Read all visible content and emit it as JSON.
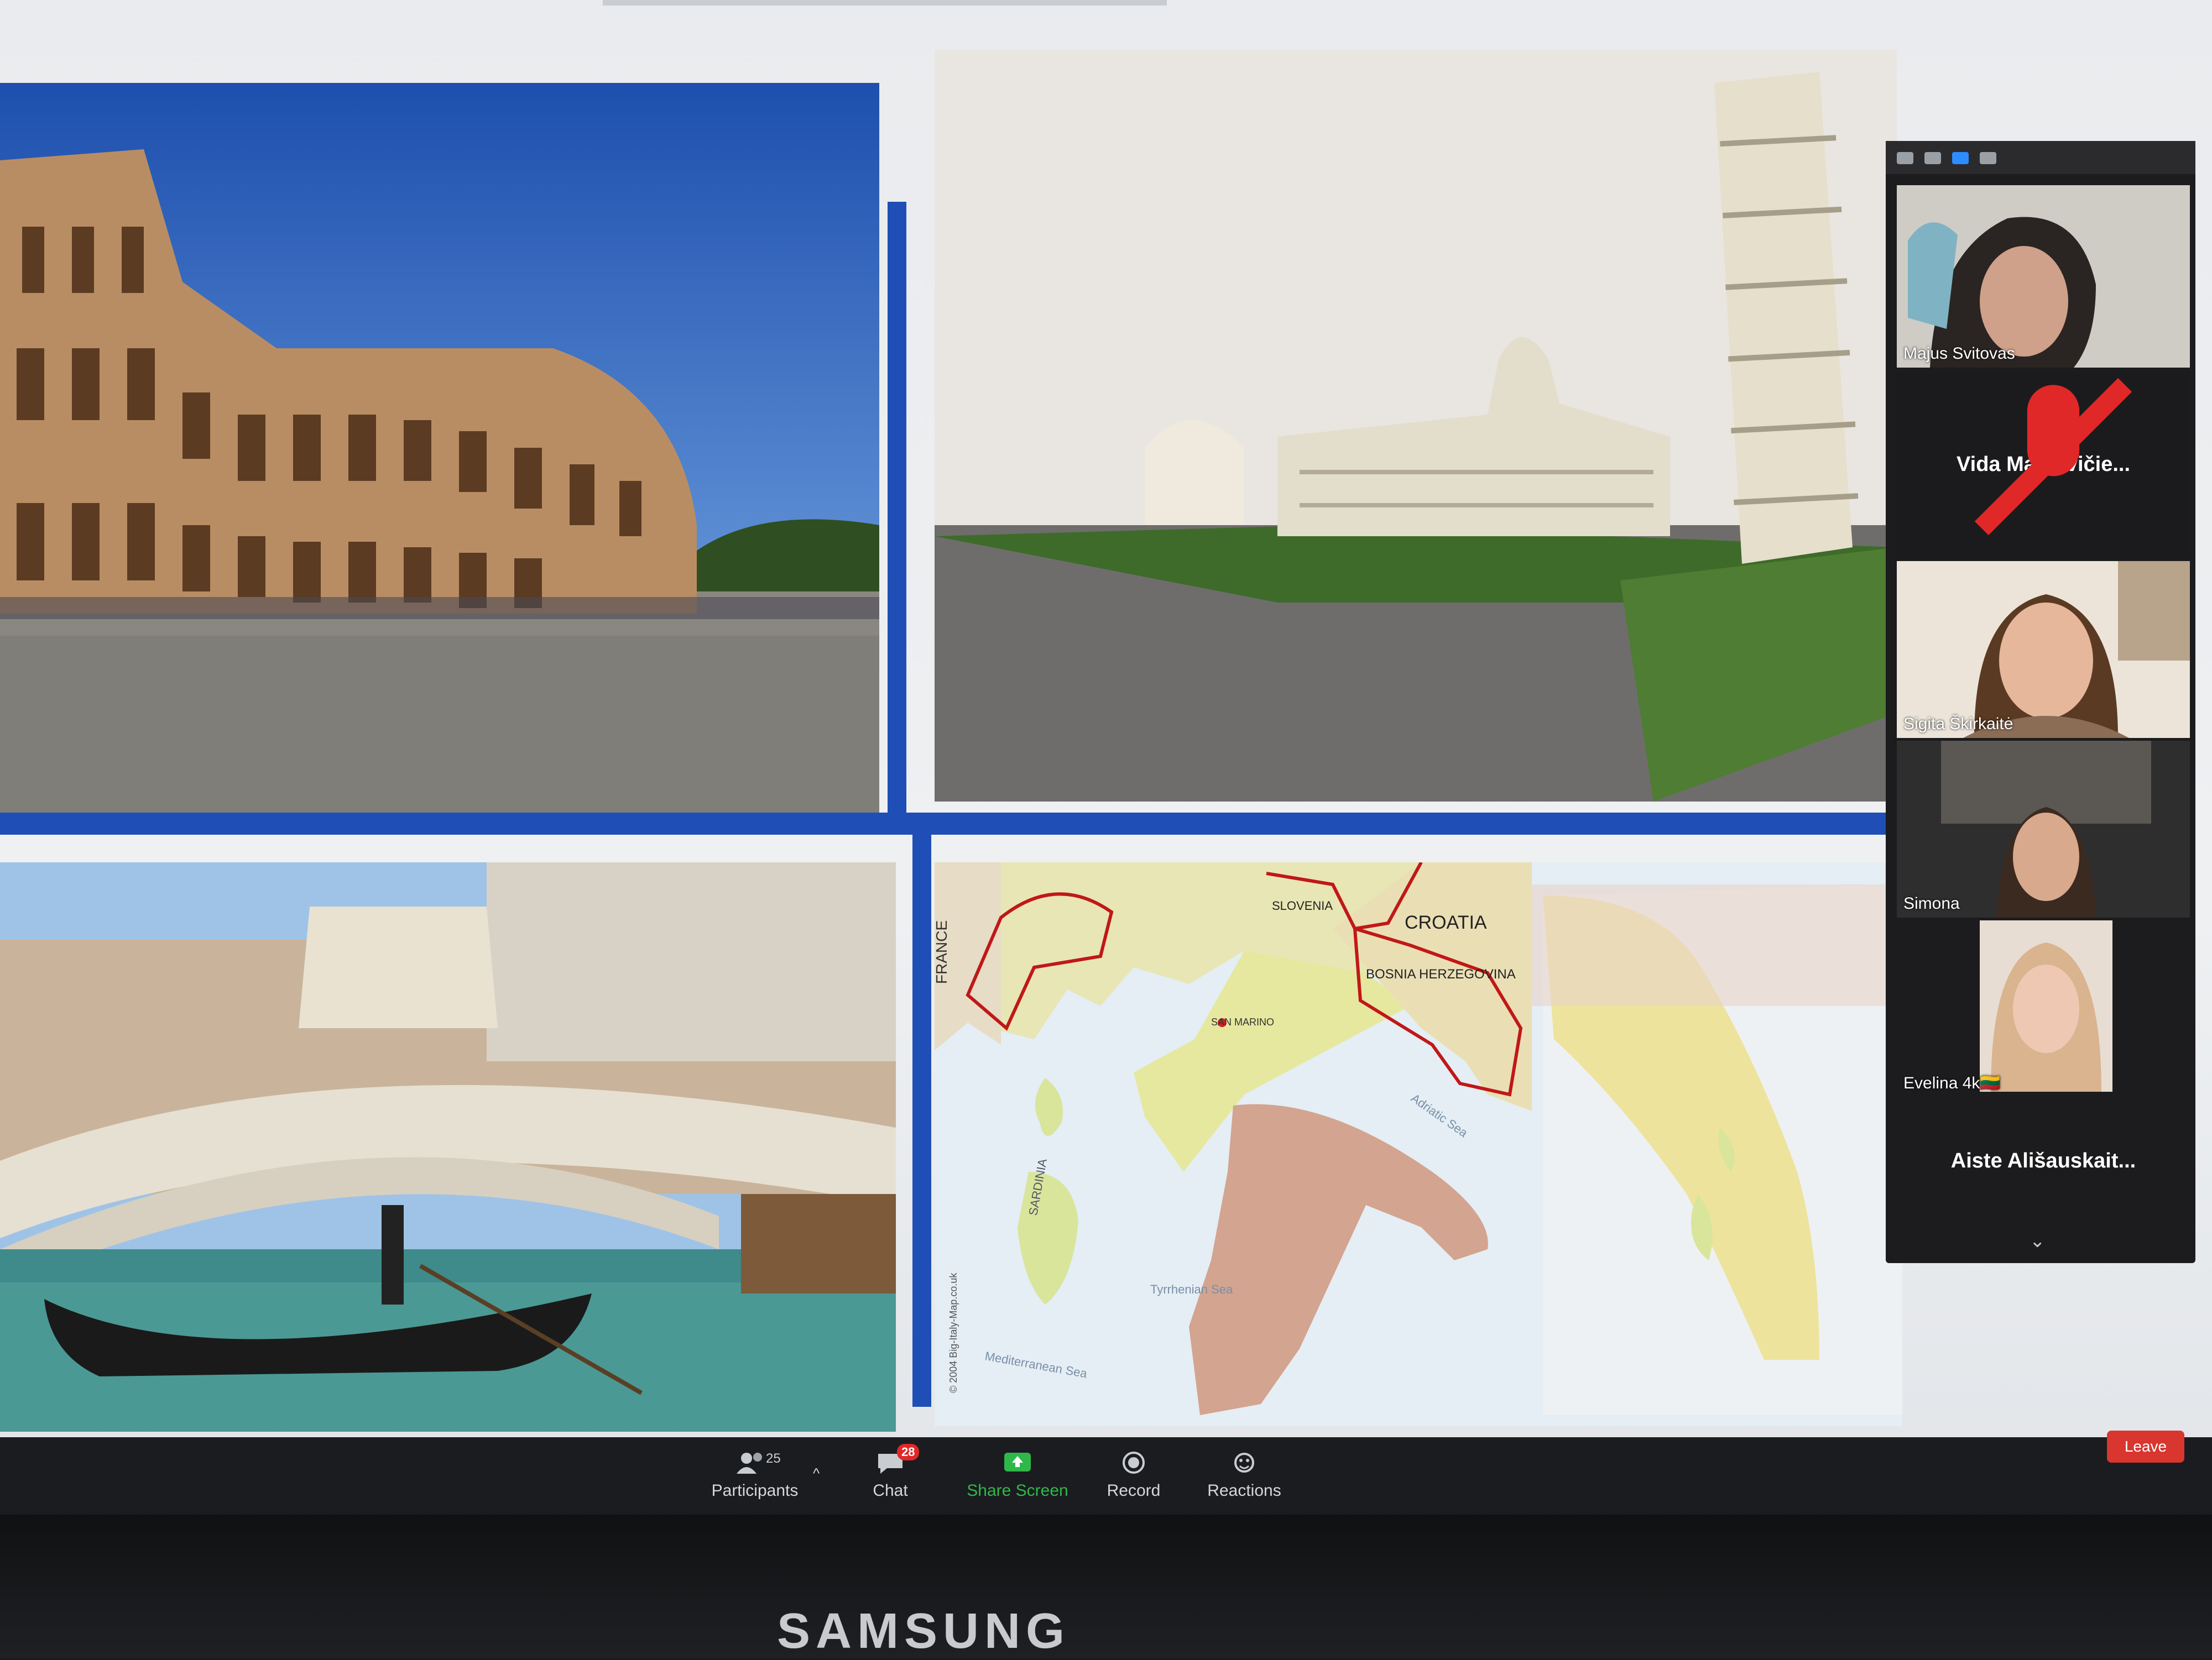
{
  "participants": [
    {
      "name": "Majus Svitovas",
      "video": true
    },
    {
      "name": "Vida Matkevičie...",
      "video": false,
      "muted": true
    },
    {
      "name": "Sigita Škirkaitė",
      "video": true
    },
    {
      "name": "Simona",
      "video": true
    },
    {
      "name": "Evelina 4k🇱🇹",
      "video": true
    },
    {
      "name": "Aiste Ališauskait...",
      "video": false
    }
  ],
  "toolbar": {
    "participants_label": "Participants",
    "participants_count": "25",
    "chat_label": "Chat",
    "chat_badge": "28",
    "share_label": "Share Screen",
    "record_label": "Record",
    "reactions_label": "Reactions",
    "leave_label": "Leave"
  },
  "map": {
    "labels": [
      "CROATIA",
      "BOSNIA HERZEGOVINA",
      "SLOVENIA",
      "FRANCE",
      "SARDINIA",
      "SAN MARINO",
      "Tyrrhenian Sea",
      "Adriatic Sea",
      "Mediterranean Sea",
      "© 2004 Big-Italy-Map.co.uk"
    ]
  },
  "monitor": {
    "brand": "SAMSUNG"
  },
  "colors": {
    "accent_blue": "#1f4fb6",
    "share_green": "#2fb84a",
    "leave_red": "#d8362f"
  }
}
